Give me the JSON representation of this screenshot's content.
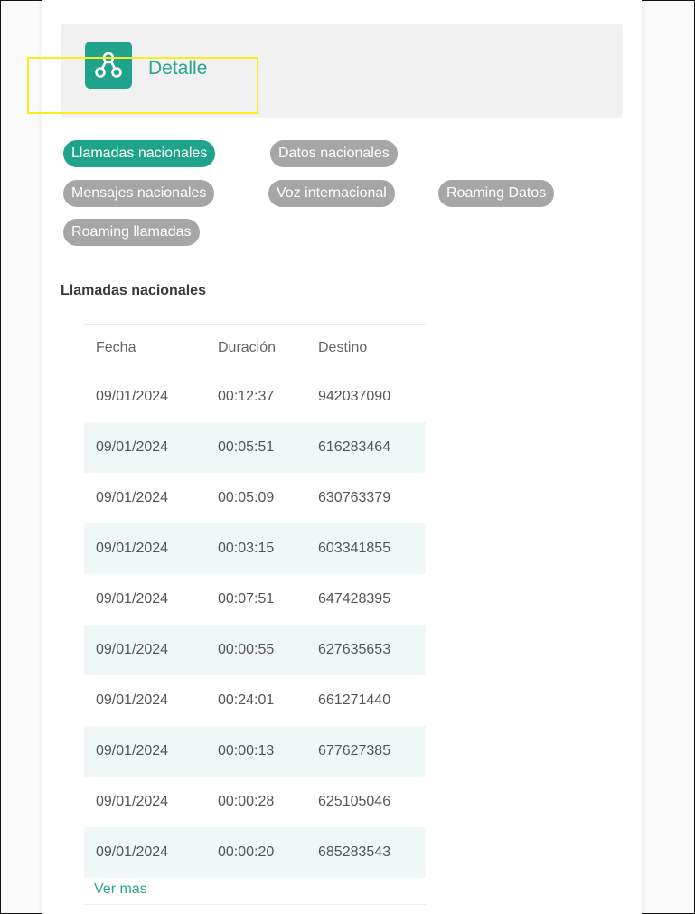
{
  "header": {
    "title": "Detalle",
    "icon": "network-nodes-icon"
  },
  "chips": [
    {
      "label": "Llamadas nacionales",
      "active": true
    },
    {
      "label": "Datos nacionales",
      "active": false
    },
    {
      "label": "Mensajes nacionales",
      "active": false
    },
    {
      "label": "Voz internacional",
      "active": false
    },
    {
      "label": "Roaming Datos",
      "active": false
    },
    {
      "label": "Roaming llamadas",
      "active": false
    }
  ],
  "section": {
    "title": "Llamadas nacionales"
  },
  "table": {
    "columns": [
      "Fecha",
      "Duración",
      "Destino"
    ],
    "rows": [
      [
        "09/01/2024",
        "00:12:37",
        "942037090"
      ],
      [
        "09/01/2024",
        "00:05:51",
        "616283464"
      ],
      [
        "09/01/2024",
        "00:05:09",
        "630763379"
      ],
      [
        "09/01/2024",
        "00:03:15",
        "603341855"
      ],
      [
        "09/01/2024",
        "00:07:51",
        "647428395"
      ],
      [
        "09/01/2024",
        "00:00:55",
        "627635653"
      ],
      [
        "09/01/2024",
        "00:24:01",
        "661271440"
      ],
      [
        "09/01/2024",
        "00:00:13",
        "677627385"
      ],
      [
        "09/01/2024",
        "00:00:28",
        "625105046"
      ],
      [
        "09/01/2024",
        "00:00:20",
        "685283543"
      ]
    ]
  },
  "ver_mas": "Ver mas",
  "colors": {
    "accent": "#1fa38b",
    "chip_inactive": "#a6a6a6",
    "row_alt": "#f0f8f7"
  }
}
